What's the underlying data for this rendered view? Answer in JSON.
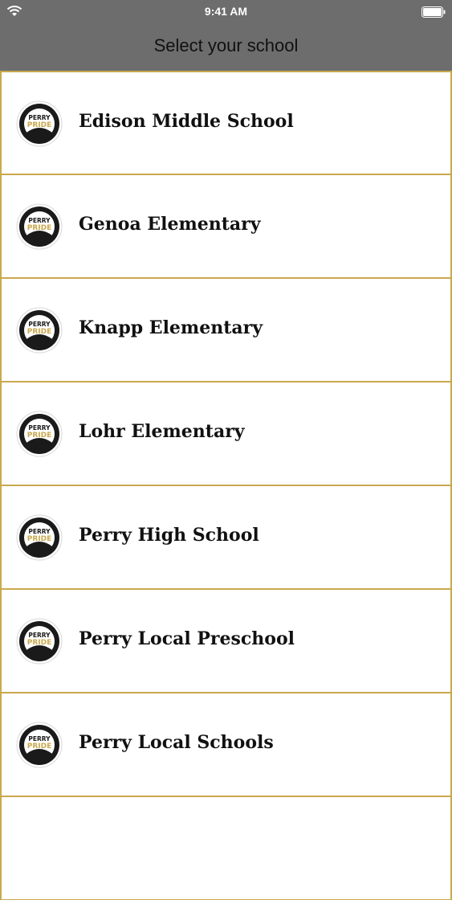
{
  "status_bar": {
    "time": "9:41 AM"
  },
  "header": {
    "title": "Select your school"
  },
  "logo": {
    "line1": "PERRY",
    "line2": "PRIDE"
  },
  "schools": [
    {
      "label": "Edison Middle School"
    },
    {
      "label": "Genoa Elementary"
    },
    {
      "label": "Knapp Elementary"
    },
    {
      "label": "Lohr Elementary"
    },
    {
      "label": "Perry High School"
    },
    {
      "label": "Perry Local Preschool"
    },
    {
      "label": "Perry Local Schools"
    }
  ],
  "colors": {
    "header_bg": "#6d6d6d",
    "border_gold": "#c9a94e",
    "logo_gold": "#c9a94e"
  }
}
